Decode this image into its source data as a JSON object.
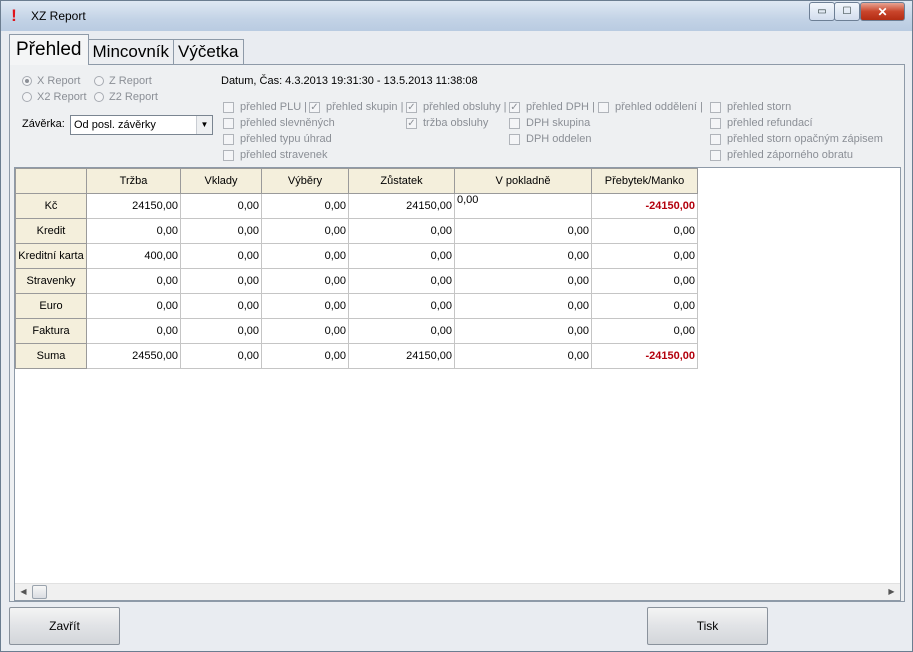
{
  "window": {
    "title": "XZ Report",
    "app_icon_glyph": "!",
    "min_glyph": "▭",
    "max_glyph": "☐",
    "close_glyph": "✕"
  },
  "tabs": [
    {
      "label": "Přehled"
    },
    {
      "label": "Mincovník"
    },
    {
      "label": "Výčetka"
    }
  ],
  "report_type": {
    "x_report": "X Report",
    "z_report": "Z Report",
    "x2_report": "X2 Report",
    "z2_report": "Z2 Report"
  },
  "zaverka": {
    "label": "Závěrka:",
    "value": "Od posl. závěrky"
  },
  "datum": "Datum, Čas:  4.3.2013 19:31:30 - 13.5.2013 11:38:08",
  "checkboxes": {
    "prehled_plu": "přehled PLU",
    "prehled_skupin": "přehled skupin",
    "prehled_obsluhy": "přehled obsluhy",
    "prehled_dph": "přehled DPH",
    "prehled_oddeleni": "přehled oddělení",
    "prehled_storn": "přehled storn",
    "prehled_slevnenych": "přehled slevněných",
    "trzba_obsluhy": "tržba obsluhy",
    "dph_skupina": "DPH skupina",
    "prehled_refundaci": "přehled refundací",
    "prehled_typu_uhrad": "přehled typu úhrad",
    "dph_oddelen": "DPH oddelen",
    "prehled_storn_opacnym": "přehled storn opačným zápisem",
    "prehled_stravenek": "přehled stravenek",
    "prehled_zaporneho": "přehled záporného obratu",
    "check_mark": "✓",
    "separator": "|"
  },
  "table": {
    "headers": [
      "Tržba",
      "Vklady",
      "Výběry",
      "Zůstatek",
      "V pokladně",
      "Přebytek/Manko"
    ],
    "rows": [
      {
        "label": "Kč",
        "cells": [
          "24150,00",
          "0,00",
          "0,00",
          "24150,00",
          "0,00",
          "-24150,00"
        ]
      },
      {
        "label": "Kredit",
        "cells": [
          "0,00",
          "0,00",
          "0,00",
          "0,00",
          "0,00",
          "0,00"
        ]
      },
      {
        "label": "Kreditní karta",
        "cells": [
          "400,00",
          "0,00",
          "0,00",
          "0,00",
          "0,00",
          "0,00"
        ]
      },
      {
        "label": "Stravenky",
        "cells": [
          "0,00",
          "0,00",
          "0,00",
          "0,00",
          "0,00",
          "0,00"
        ]
      },
      {
        "label": "Euro",
        "cells": [
          "0,00",
          "0,00",
          "0,00",
          "0,00",
          "0,00",
          "0,00"
        ]
      },
      {
        "label": "Faktura",
        "cells": [
          "0,00",
          "0,00",
          "0,00",
          "0,00",
          "0,00",
          "0,00"
        ]
      },
      {
        "label": "Suma",
        "cells": [
          "24550,00",
          "0,00",
          "0,00",
          "24150,00",
          "0,00",
          "-24150,00"
        ]
      }
    ]
  },
  "scrollbar": {
    "left_arrow": "◀",
    "right_arrow": "▶"
  },
  "buttons": {
    "zavrit": "Zavřít",
    "tisk": "Tisk"
  }
}
